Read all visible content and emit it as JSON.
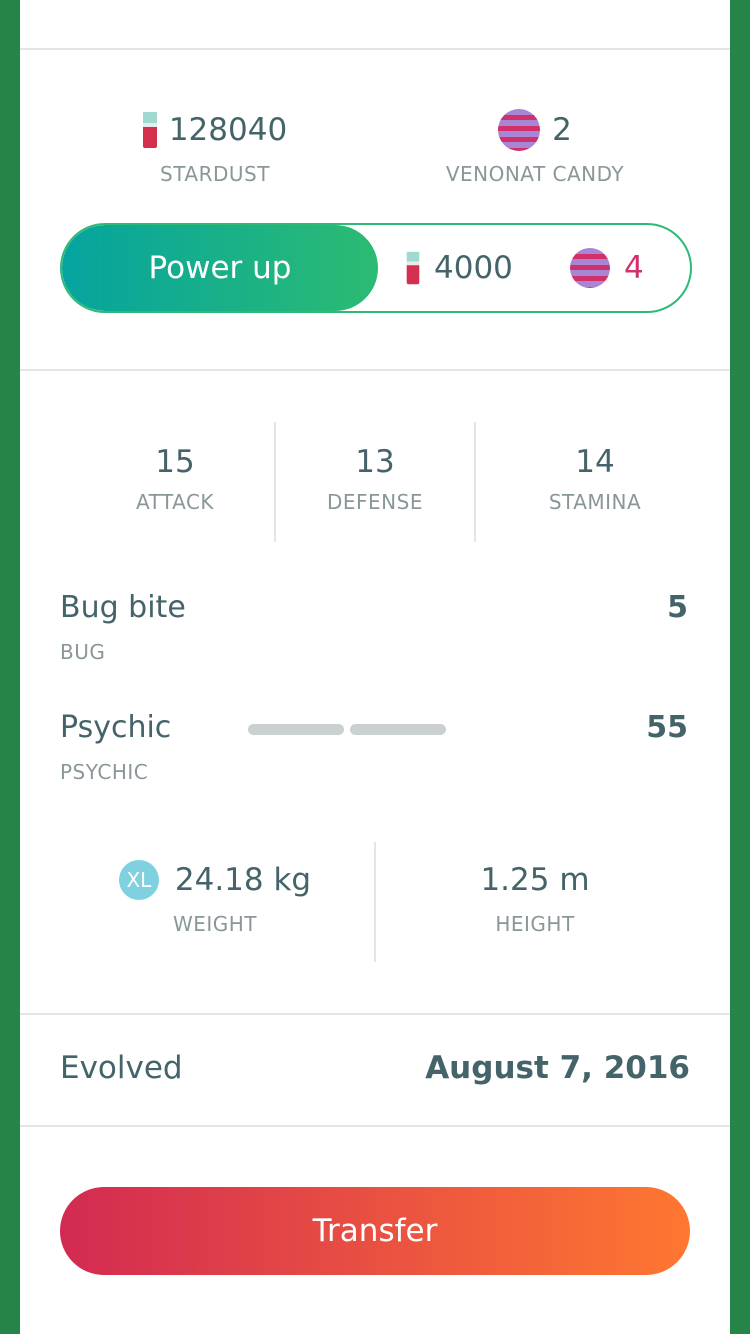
{
  "resources": {
    "stardust_value": "128040",
    "stardust_label": "STARDUST",
    "candy_value": "2",
    "candy_label": "VENONAT CANDY"
  },
  "power_up": {
    "label": "Power up",
    "stardust_cost": "4000",
    "candy_cost": "4"
  },
  "stats": [
    {
      "value": "15",
      "label": "ATTACK"
    },
    {
      "value": "13",
      "label": "DEFENSE"
    },
    {
      "value": "14",
      "label": "STAMINA"
    }
  ],
  "moves": [
    {
      "name": "Bug bite",
      "type": "BUG",
      "power": "5"
    },
    {
      "name": "Psychic",
      "type": "PSYCHIC",
      "power": "55",
      "energy_segments": 2
    }
  ],
  "measurements": {
    "xl_badge": "XL",
    "weight_value": "24.18 kg",
    "weight_label": "WEIGHT",
    "height_value": "1.25 m",
    "height_label": "HEIGHT"
  },
  "evolved": {
    "label": "Evolved",
    "date": "August 7, 2016"
  },
  "transfer": {
    "label": "Transfer"
  },
  "colors": {
    "background_green": "#258447",
    "power_gradient_start": "#05a49f",
    "power_gradient_end": "#2cbb72",
    "transfer_gradient_start": "#d22a52",
    "transfer_gradient_end": "#ff7731",
    "candy_cost_red": "#d0316d"
  },
  "icons": {
    "stardust": "stardust-icon",
    "candy": "venonat-candy-icon",
    "xl": "xl-badge-icon"
  }
}
